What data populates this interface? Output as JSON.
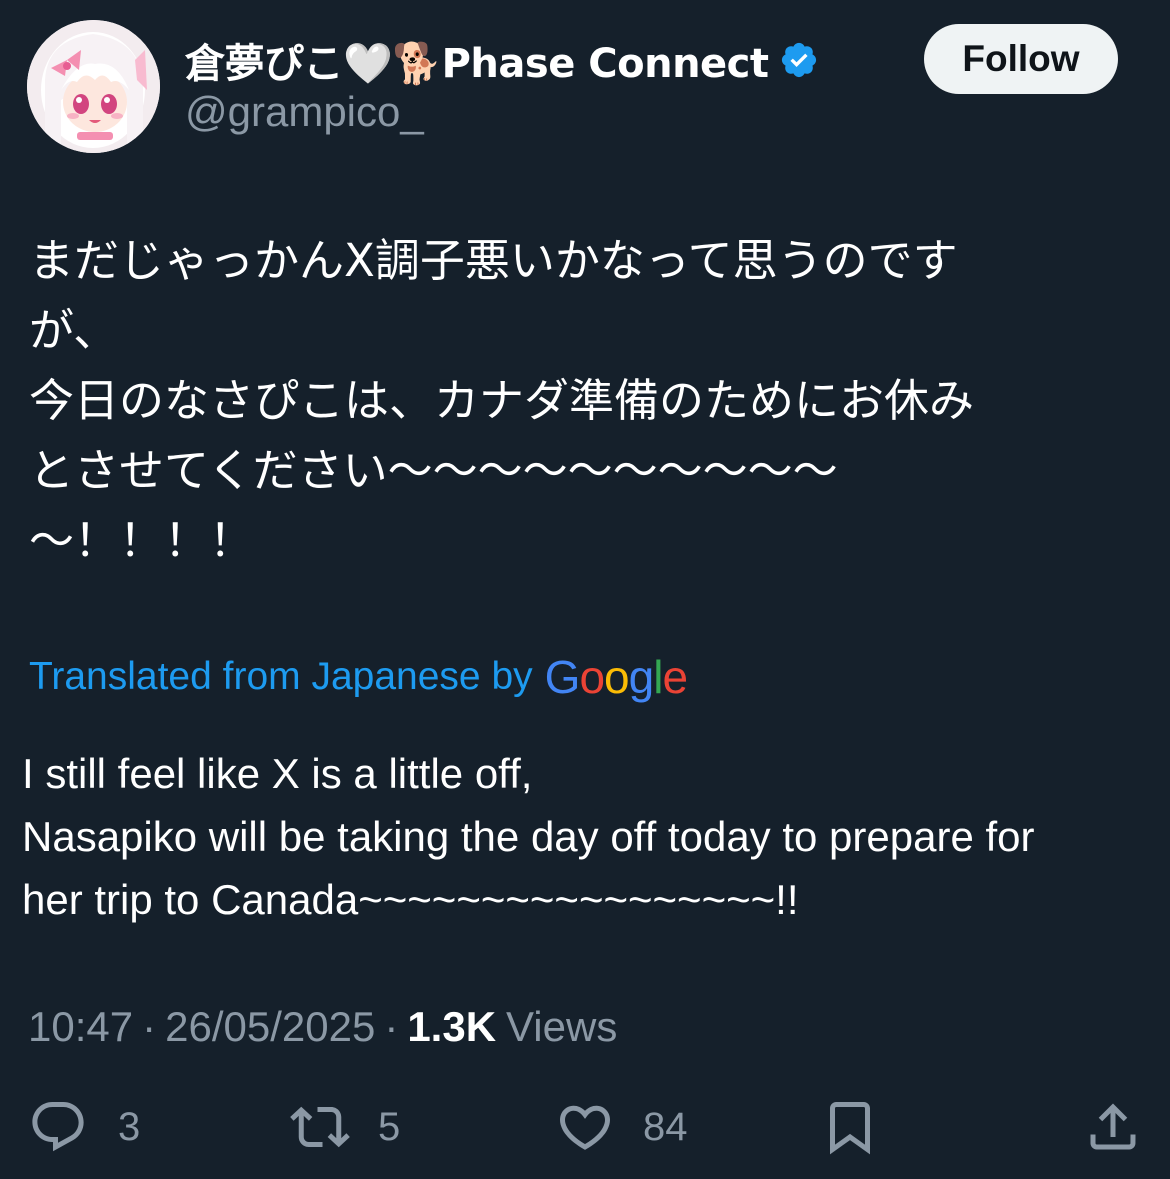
{
  "author": {
    "display_name": "倉夢ぴこ🤍🐕Phase Connect",
    "handle": "@grampico_",
    "verified": true
  },
  "follow_button": {
    "label": "Follow"
  },
  "tweet": {
    "lines": [
      "まだじゃっかんX調子悪いかなって思うのです",
      "が、",
      "今日のなさぴこは、カナダ準備のためにお休み",
      "とさせてください〜〜〜〜〜〜〜〜〜〜",
      "〜！！！！"
    ]
  },
  "translation": {
    "label": "Translated from Japanese by",
    "logo_text": "Google",
    "lines": [
      "I still feel like X is a little off,",
      "Nasapiko will be taking the day off today to prepare for",
      "her trip to Canada~~~~~~~~~~~~~~~~~!!"
    ]
  },
  "meta": {
    "time": "10:47",
    "date": "26/05/2025",
    "views_count": "1.3K",
    "views_label": "Views",
    "separator": "·"
  },
  "actions": {
    "replies": "3",
    "reposts": "5",
    "likes": "84"
  },
  "colors": {
    "background": "#15202b",
    "secondary_text": "#8b98a5",
    "link_blue": "#1d9bf0",
    "verified_blue": "#1d9bf0",
    "google_blue": "#4285f4",
    "google_red": "#ea4335",
    "google_yellow": "#fbbc05",
    "google_green": "#34a853"
  }
}
